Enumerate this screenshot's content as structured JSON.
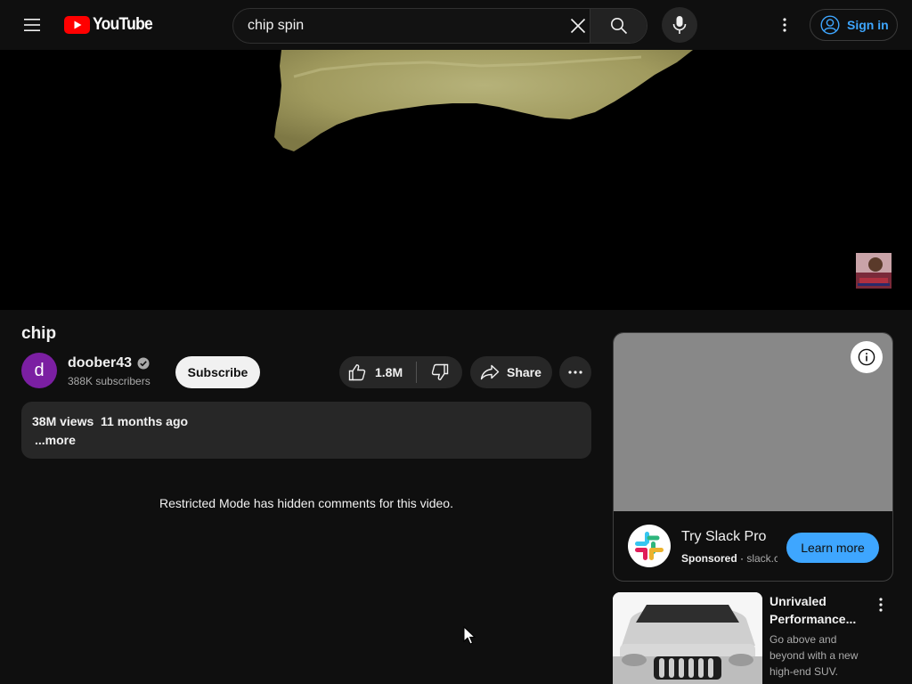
{
  "header": {
    "logo_text": "YouTube",
    "search_value": "chip spin",
    "signin_label": "Sign in",
    "icons": [
      "menu-icon",
      "search-clear-icon",
      "search-icon",
      "mic-icon",
      "more-vert-icon",
      "account-icon"
    ]
  },
  "video": {
    "title": "chip",
    "channel": {
      "avatar_letter": "d",
      "name": "doober43",
      "verified": true,
      "subscribers": "388K subscribers"
    },
    "subscribe_label": "Subscribe",
    "likes": "1.8M",
    "share_label": "Share",
    "description": {
      "meta": "38M views  11 months ago",
      "more_label": "...more"
    },
    "comments_notice": "Restricted Mode has hidden comments for this video."
  },
  "ad": {
    "title": "Try Slack Pro",
    "sponsored_label": "Sponsored",
    "separator": " · ",
    "domain": "slack.com",
    "cta_label": "Learn more"
  },
  "related": {
    "title_line1": "Unrivaled",
    "title_line2": "Performance...",
    "desc_line1": "Go above and",
    "desc_line2": "beyond with a new",
    "desc_line3": "high-end SUV."
  },
  "colors": {
    "background": "#0f0f0f",
    "accent_blue": "#3ea6ff",
    "chip_button": "#272727",
    "brand_red": "#ff0000",
    "avatar_purple": "#7b1fa2"
  }
}
